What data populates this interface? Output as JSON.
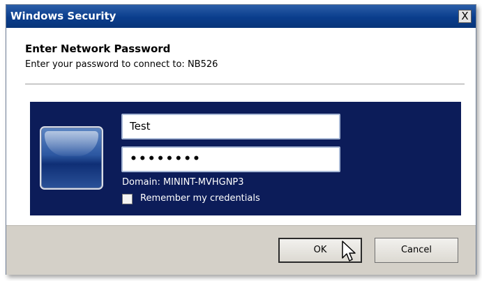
{
  "window": {
    "title": "Windows Security",
    "close_label": "X"
  },
  "dialog": {
    "heading": "Enter Network Password",
    "subheading": "Enter your password to connect to: NB526"
  },
  "credentials": {
    "username_value": "Test",
    "password_value": "••••••••",
    "domain_text": "Domain: MININT-MVHGNP3",
    "remember_label": "Remember my credentials",
    "remember_checked": false
  },
  "buttons": {
    "ok_label": "OK",
    "cancel_label": "Cancel"
  },
  "colors": {
    "titlebar": "#0a3d8c",
    "panel": "#0c1c59",
    "footer": "#d4d0c8"
  },
  "icons": {
    "user_tile": "user-tile-icon",
    "cursor": "mouse-pointer-icon"
  }
}
